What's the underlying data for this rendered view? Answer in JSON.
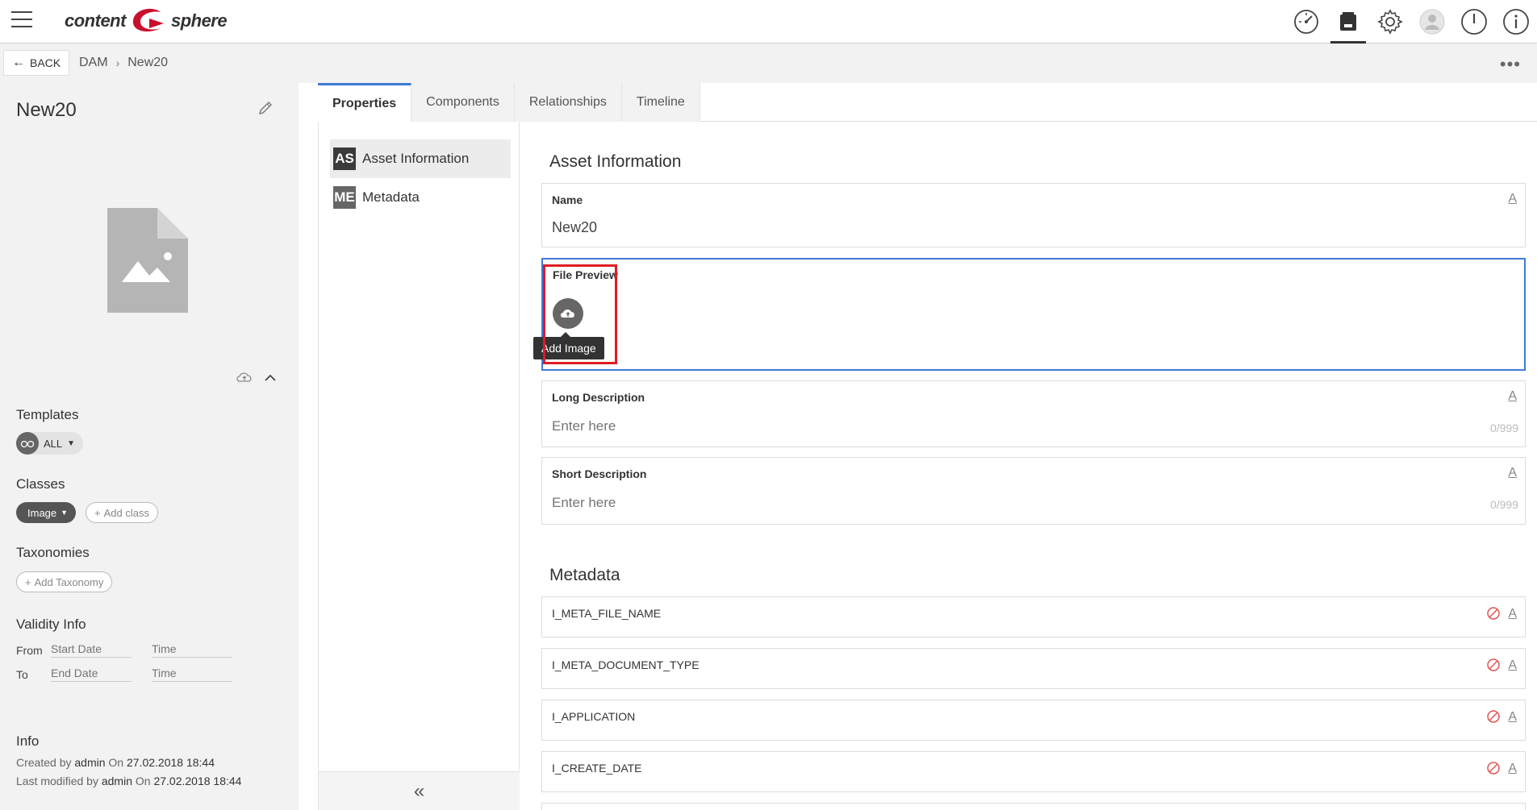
{
  "app": {
    "logo_left": "content",
    "logo_right": "sphere"
  },
  "topbar": {
    "icons": [
      "dashboard-icon",
      "dam-icon",
      "settings-icon",
      "user-avatar-icon",
      "power-icon",
      "info-icon"
    ]
  },
  "subbar": {
    "back_label": "BACK",
    "breadcrumb": [
      "DAM",
      "New20"
    ],
    "more_label": "•••"
  },
  "sidebar": {
    "asset_title": "New20",
    "templates_label": "Templates",
    "templates_value": "ALL",
    "classes_label": "Classes",
    "class_value": "Image",
    "add_class_label": "Add class",
    "taxonomies_label": "Taxonomies",
    "add_taxonomy_label": "Add Taxonomy",
    "validity_label": "Validity Info",
    "from_label": "From",
    "to_label": "To",
    "start_date_placeholder": "Start Date",
    "end_date_placeholder": "End Date",
    "time_placeholder": "Time",
    "info_label": "Info",
    "created_by_prefix": "Created by",
    "created_by_user": "admin",
    "on_label": "On",
    "created_on": "27.02.2018 18:44",
    "modified_by_prefix": "Last modified by",
    "modified_by_user": "admin",
    "modified_on": "27.02.2018 18:44"
  },
  "tabs": [
    "Properties",
    "Components",
    "Relationships",
    "Timeline"
  ],
  "nav": [
    {
      "badge": "AS",
      "label": "Asset Information"
    },
    {
      "badge": "ME",
      "label": "Metadata"
    }
  ],
  "collapse_label": "«",
  "form": {
    "asset_section_title": "Asset Information",
    "name_label": "Name",
    "name_value": "New20",
    "file_preview_label": "File Preview",
    "add_image_tooltip": "Add Image",
    "long_desc_label": "Long Description",
    "short_desc_label": "Short Description",
    "placeholder": "Enter here",
    "counter": "0/999",
    "font_icon_label": "A",
    "metadata_section_title": "Metadata",
    "meta_fields": [
      "I_META_FILE_NAME",
      "I_META_DOCUMENT_TYPE",
      "I_APPLICATION",
      "I_CREATE_DATE"
    ]
  },
  "colors": {
    "accent": "#3d7bd7",
    "highlight": "#e01b24",
    "brand_red": "#c8102e"
  }
}
